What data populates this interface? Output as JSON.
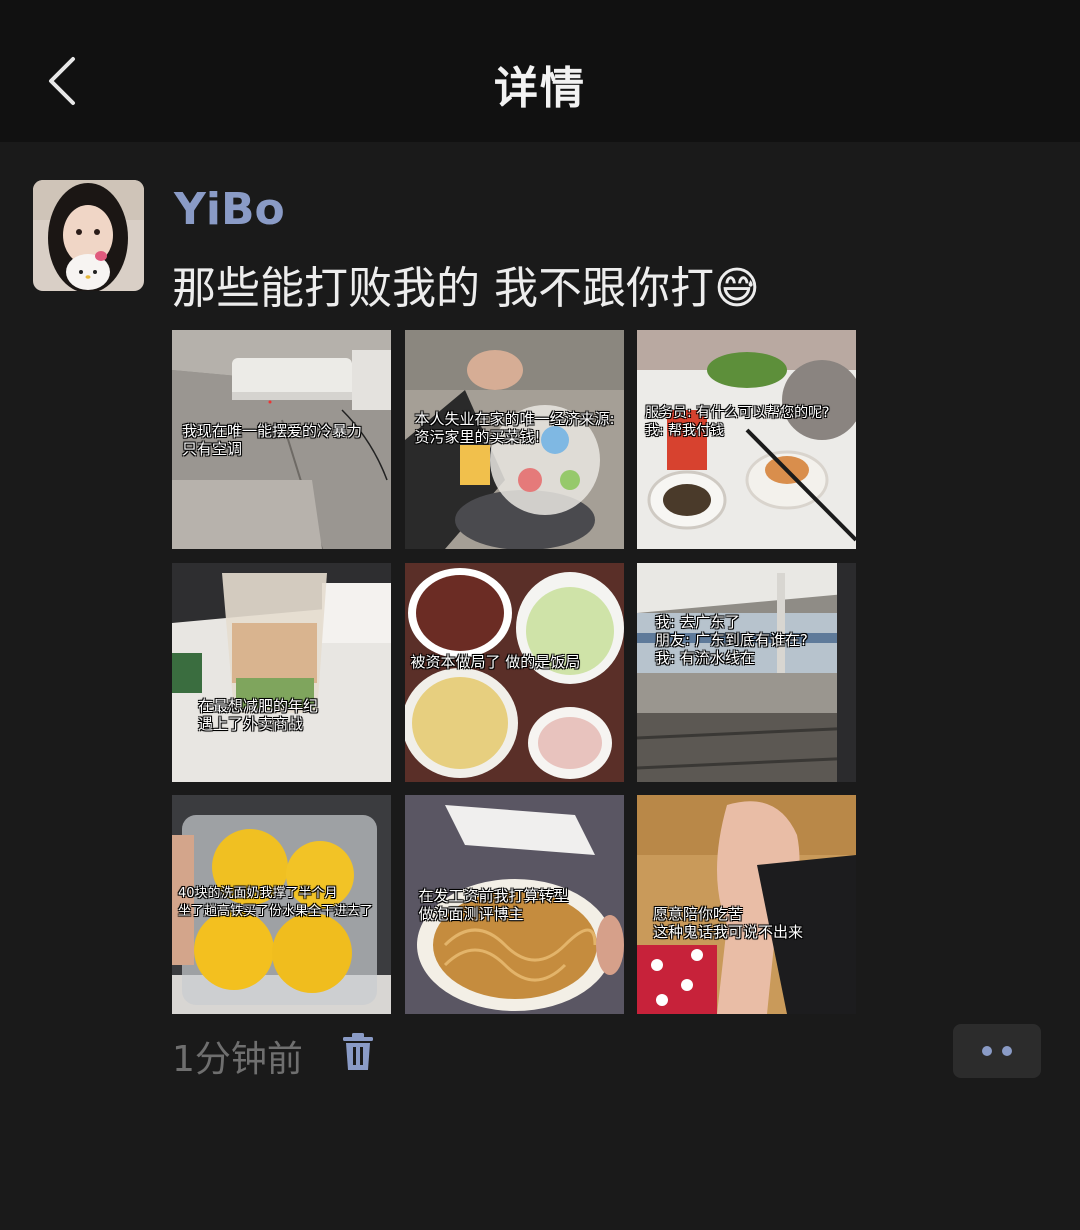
{
  "header": {
    "title": "详情",
    "back_icon": "chevron-left-icon"
  },
  "post": {
    "username": "YiBo",
    "text": "那些能打败我的 我不跟你打😅",
    "timestamp": "1分钟前",
    "photos": [
      {
        "caption": "我现在唯一能摆爱的冷暴力\n只有空调"
      },
      {
        "caption": "本人失业在家的唯一经济来源:\n资污家里的买菜钱!"
      },
      {
        "caption": "服务员: 有什么可以帮您的呢?\n我: 帮我付钱"
      },
      {
        "caption": "在最想减肥的年纪\n遇上了外卖商战"
      },
      {
        "caption": "被资本做局了 做的是饭局"
      },
      {
        "caption": "我: 去广东了\n朋友: 广东到底有谁在?\n我: 有流水线在"
      },
      {
        "caption": "40块的洗面奶我撑了半个月\n坐了趟高铁买了份水果全干进去了"
      },
      {
        "caption": "在发工资前我打算转型\n做泡面测评博主"
      },
      {
        "caption": "愿意陪你吃苦\n这种鬼话我可说不出来"
      }
    ]
  },
  "colors": {
    "background": "#1a1a1a",
    "header_bg": "#111111",
    "username": "#8a9bc6",
    "timestamp": "#6f6f6f"
  }
}
